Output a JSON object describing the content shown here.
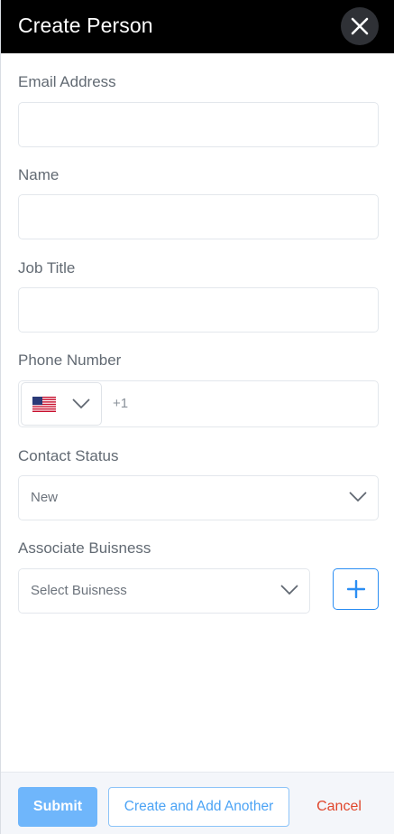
{
  "header": {
    "title": "Create Person",
    "close_icon": "close-icon"
  },
  "fields": {
    "email": {
      "label": "Email Address",
      "value": "",
      "placeholder": ""
    },
    "name": {
      "label": "Name",
      "value": "",
      "placeholder": ""
    },
    "job_title": {
      "label": "Job Title",
      "value": "",
      "placeholder": ""
    },
    "phone": {
      "label": "Phone Number",
      "country_flag": "us-flag-icon",
      "dial_code": "+1"
    },
    "contact_status": {
      "label": "Contact Status",
      "selected": "New"
    },
    "business": {
      "label": "Associate Buisness",
      "selected": "Select Buisness",
      "add_icon": "plus-icon"
    }
  },
  "footer": {
    "submit_label": "Submit",
    "create_another_label": "Create and Add Another",
    "cancel_label": "Cancel"
  },
  "colors": {
    "header_bg": "#000000",
    "primary": "#2b8ef3",
    "submit_bg": "#6fb6fb",
    "cancel": "#e0462c",
    "footer_bg": "#f4f6fa"
  }
}
